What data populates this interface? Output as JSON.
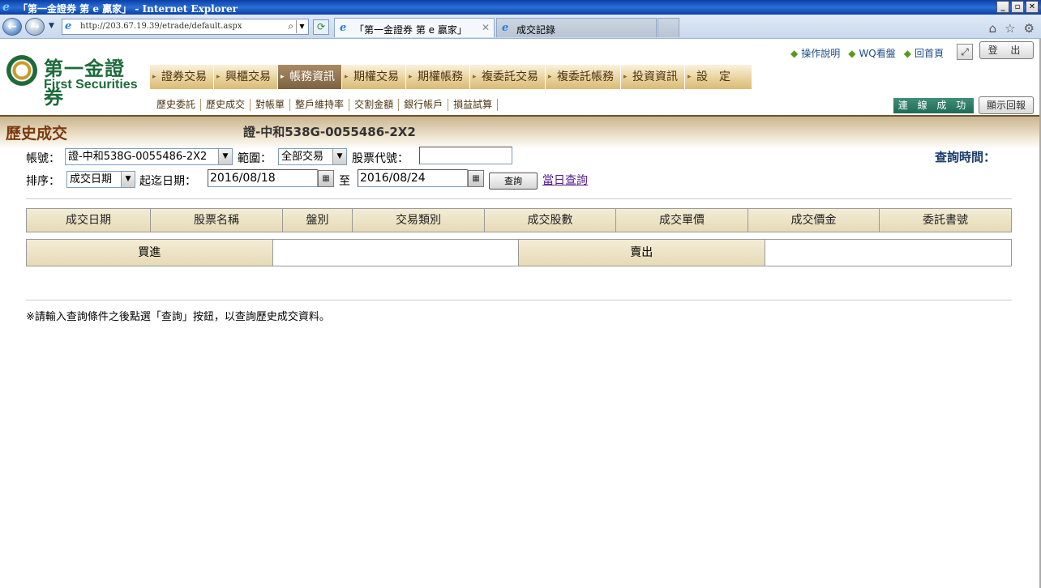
{
  "window": {
    "title": "「第一金證券 第 e 贏家」 - Internet Explorer",
    "min_label": "_",
    "max_label": "▫",
    "close_label": "✕"
  },
  "browser": {
    "url": "http://203.67.19.39/etrade/default.aspx",
    "tabs": [
      {
        "label": "「第一金證券 第 e 贏家」",
        "close": "✕"
      },
      {
        "label": "成交記錄"
      }
    ]
  },
  "header": {
    "logo_cn": "第一金證券",
    "logo_en": "First Securities",
    "links": [
      "操作說明",
      "WQ看盤",
      "回首頁"
    ],
    "logout_label": "登 出",
    "connection_status": "連 線 成 功",
    "reply_label": "顯示回報"
  },
  "main_nav": {
    "items": [
      "證券交易",
      "興櫃交易",
      "帳務資訊",
      "期權交易",
      "期權帳務",
      "複委託交易",
      "複委託帳務",
      "投資資訊",
      "設　定"
    ],
    "active": "帳務資訊"
  },
  "sub_nav": {
    "items": [
      "歷史委託",
      "歷史成交",
      "對帳單",
      "整戶維持率",
      "交割金額",
      "銀行帳戶",
      "損益試算"
    ]
  },
  "page": {
    "title": "歷史成交",
    "account_display": "證-中和538G-0055486-2X2",
    "query_time_label": "查詢時間："
  },
  "form": {
    "account_label": "帳號：",
    "account_value": "證-中和538G-0055486-2X2",
    "range_label": "範圍：",
    "range_value": "全部交易",
    "stock_code_label": "股票代號：",
    "stock_code_value": "",
    "sort_label": "排序：",
    "sort_value": "成交日期",
    "date_range_label": "起迄日期：",
    "start_date": "2016/08/18",
    "to_label": "至",
    "end_date": "2016/08/24",
    "query_button": "查詢",
    "today_query_link": "當日查詢"
  },
  "table": {
    "columns": [
      "成交日期",
      "股票名稱",
      "盤別",
      "交易類別",
      "成交股數",
      "成交單價",
      "成交價金",
      "委託書號"
    ]
  },
  "summary": {
    "buy_label": "買進",
    "buy_value": "",
    "sell_label": "賣出",
    "sell_value": ""
  },
  "note": "※請輸入查詢條件之後點選「查詢」按鈕，以查詢歷史成交資料。",
  "colors": {
    "title_bar": "#0a3fa6",
    "nav_gold": "#e8d29e",
    "nav_active": "#7d6240",
    "connection_green": "#1f6b55",
    "brand_green": "#1e6b3a",
    "page_title": "#7a3a10"
  }
}
